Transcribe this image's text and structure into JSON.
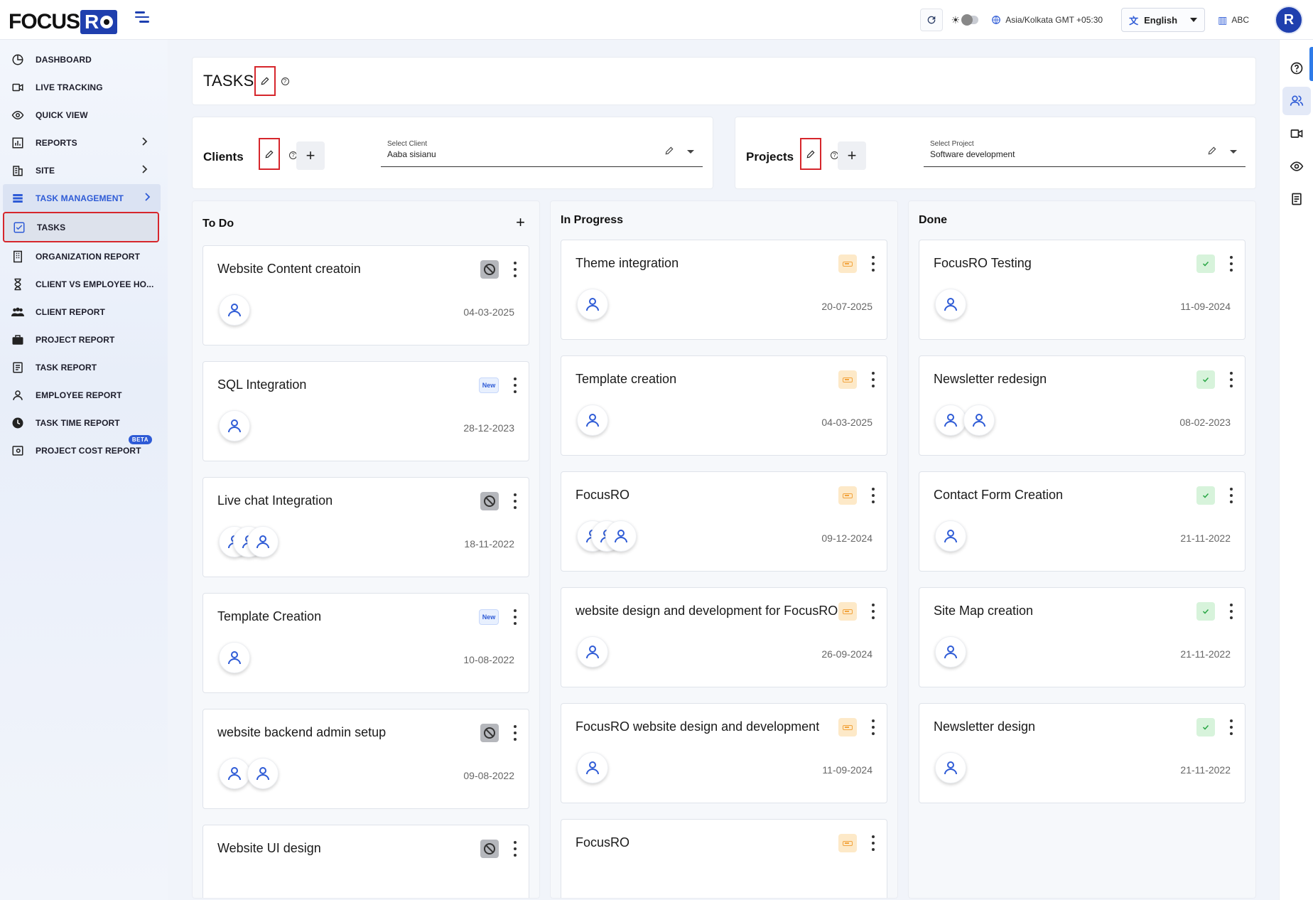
{
  "header": {
    "logo_text": "FOCUS",
    "logo_box": "R",
    "timezone": "Asia/Kolkata GMT +05:30",
    "language": "English",
    "org": "ABC",
    "avatar": "R"
  },
  "sidebar": {
    "items": [
      {
        "label": "DASHBOARD",
        "icon": "dashboard-icon"
      },
      {
        "label": "LIVE TRACKING",
        "icon": "video-icon"
      },
      {
        "label": "QUICK VIEW",
        "icon": "eye-icon"
      },
      {
        "label": "REPORTS",
        "icon": "report-chart-icon"
      },
      {
        "label": "SITE",
        "icon": "building-icon"
      },
      {
        "label": "TASK MANAGEMENT",
        "icon": "task-management-icon"
      },
      {
        "label": "TASKS",
        "icon": "checkbox-icon"
      },
      {
        "label": "ORGANIZATION REPORT",
        "icon": "organization-icon"
      },
      {
        "label": "CLIENT VS EMPLOYEE HO...",
        "icon": "hourglass-icon"
      },
      {
        "label": "CLIENT REPORT",
        "icon": "group-icon"
      },
      {
        "label": "PROJECT REPORT",
        "icon": "briefcase-icon"
      },
      {
        "label": "TASK REPORT",
        "icon": "document-icon"
      },
      {
        "label": "EMPLOYEE REPORT",
        "icon": "person-icon"
      },
      {
        "label": "TASK TIME REPORT",
        "icon": "clock-icon"
      },
      {
        "label": "PROJECT COST REPORT",
        "icon": "cost-icon",
        "badge": "BETA"
      }
    ]
  },
  "page": {
    "title": "TASKS",
    "help": "?"
  },
  "filters": {
    "clients": {
      "label": "Clients",
      "select_label": "Select Client",
      "value": "Aaba sisianu"
    },
    "projects": {
      "label": "Projects",
      "select_label": "Select Project",
      "value": "Software development"
    }
  },
  "board": {
    "columns": [
      {
        "title": "To Do",
        "cards": [
          {
            "title": "Website Content creatoin",
            "status": "blocked",
            "date": "04-03-2025",
            "assignees": 1
          },
          {
            "title": "SQL Integration",
            "status": "new",
            "badge": "New",
            "date": "28-12-2023",
            "assignees": 1
          },
          {
            "title": "Live chat Integration",
            "status": "blocked",
            "date": "18-11-2022",
            "assignees": 3
          },
          {
            "title": "Template Creation",
            "status": "new",
            "badge": "New",
            "date": "10-08-2022",
            "assignees": 1
          },
          {
            "title": "website backend admin setup",
            "status": "blocked",
            "date": "09-08-2022",
            "assignees": 2
          },
          {
            "title": "Website UI design",
            "status": "blocked",
            "date": "",
            "assignees": 0
          }
        ]
      },
      {
        "title": "In Progress",
        "cards": [
          {
            "title": "Theme integration",
            "status": "progress",
            "date": "20-07-2025",
            "assignees": 1
          },
          {
            "title": "Template creation",
            "status": "progress",
            "date": "04-03-2025",
            "assignees": 1
          },
          {
            "title": "FocusRO",
            "status": "progress",
            "date": "09-12-2024",
            "assignees": 3
          },
          {
            "title": "website design and development for FocusRO",
            "status": "progress",
            "date": "26-09-2024",
            "assignees": 1
          },
          {
            "title": "FocusRO website design and development",
            "status": "progress",
            "date": "11-09-2024",
            "assignees": 1
          },
          {
            "title": "FocusRO",
            "status": "progress",
            "date": "",
            "assignees": 0
          }
        ]
      },
      {
        "title": "Done",
        "cards": [
          {
            "title": "FocusRO Testing",
            "status": "done",
            "date": "11-09-2024",
            "assignees": 1
          },
          {
            "title": "Newsletter redesign",
            "status": "done",
            "date": "08-02-2023",
            "assignees": 2
          },
          {
            "title": "Contact Form Creation",
            "status": "done",
            "date": "21-11-2022",
            "assignees": 1
          },
          {
            "title": "Site Map creation",
            "status": "done",
            "date": "21-11-2022",
            "assignees": 1
          },
          {
            "title": "Newsletter design",
            "status": "done",
            "date": "21-11-2022",
            "assignees": 1
          }
        ]
      }
    ]
  },
  "colors": {
    "accent": "#2e5bd6",
    "highlight_outline": "#d6262c",
    "progress_badge": "#f2a33c",
    "done_badge": "#29a745"
  }
}
